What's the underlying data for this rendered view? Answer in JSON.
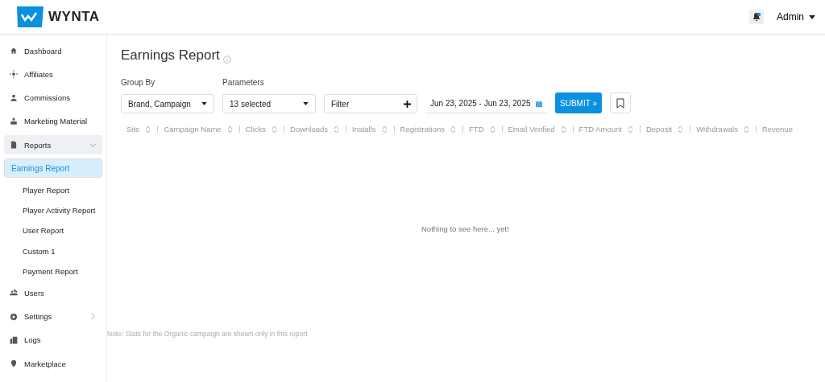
{
  "header": {
    "logo": "WYNTA",
    "user": "Admin"
  },
  "sidebar": {
    "items": [
      {
        "label": "Dashboard",
        "kind": "link",
        "selected": false
      },
      {
        "label": "Affiliates",
        "kind": "link",
        "selected": false
      },
      {
        "label": "Commissions",
        "kind": "link",
        "selected": false
      },
      {
        "label": "Marketing Material",
        "kind": "link",
        "selected": false
      },
      {
        "label": "Reports",
        "kind": "group",
        "selected": false,
        "expanded": true,
        "children": [
          {
            "label": "Earnings Report",
            "selected": true
          },
          {
            "label": "Player Report",
            "selected": false
          },
          {
            "label": "Player Activity Report",
            "selected": false
          },
          {
            "label": "User Report",
            "selected": false
          },
          {
            "label": "Custom 1",
            "selected": false
          },
          {
            "label": "Payment Report",
            "selected": false
          }
        ]
      },
      {
        "label": "Users",
        "kind": "link",
        "selected": false
      },
      {
        "label": "Settings",
        "kind": "group",
        "selected": false,
        "expanded": false
      },
      {
        "label": "Logs",
        "kind": "link",
        "selected": false
      },
      {
        "label": "Marketplace",
        "kind": "link",
        "selected": false
      }
    ]
  },
  "page": {
    "title": "Earnings Report",
    "group_by": {
      "label": "Group By",
      "value": "Brand, Campaign"
    },
    "parameters": {
      "label": "Parameters",
      "value": "13 selected"
    },
    "filter": {
      "placeholder": "Filter"
    },
    "date_range": "Jun 23, 2025 - Jun 23, 2025",
    "submit": "SUBMIT »",
    "table": {
      "columns": [
        "Site",
        "Campaign Name",
        "Clicks",
        "Downloads",
        "Installs",
        "Registrations",
        "FTD",
        "Email Verified",
        "FTD Amount",
        "Deposit",
        "Withdrawals",
        "Revenue"
      ]
    },
    "empty_message": "Nothing to see here... yet!",
    "note": "Note: Stats for the Organic campaign are shown only in this report"
  }
}
